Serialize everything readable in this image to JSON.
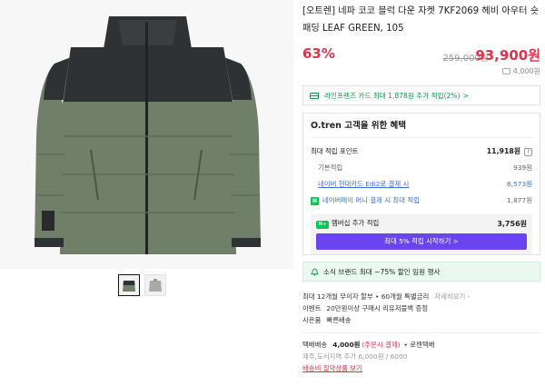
{
  "product": {
    "title": "[오트렌] 네파 코코 블럭 다운 자켓 7KF2069 헤비 아우터 숏 패딩 LEAF GREEN, 105",
    "discount_rate": "63%",
    "original_price": "259,000원",
    "final_price": "93,900원",
    "points_reward": "4,000원",
    "colors": {
      "sale": "#e0334b",
      "accent_green": "#0a9a49",
      "member_button": "#6a44ee",
      "jacket_top": "#2f3234",
      "jacket_bottom": "#6f7f68"
    }
  },
  "thumbnails": [
    {
      "name": "black-green-jacket",
      "active": true
    },
    {
      "name": "grey-jacket",
      "active": false
    }
  ],
  "card_promo": {
    "text": "라인프렌즈 카드 최대 1,878원 추가 적립(2%)",
    "chevron": ">"
  },
  "benefit": {
    "title": "O.tren 고객을 위한 혜택",
    "max_points_label": "최대 적립 포인트",
    "max_points_value": "11,918원",
    "help_icon": "?",
    "rows": [
      {
        "label": "기본적립",
        "value": "939원"
      },
      {
        "label": "네이버 현대카드 Edi2로 결제 시",
        "value": "6,573원"
      },
      {
        "label": "네이버페이 머니 결제 시 최대 적립",
        "value": "1,877원"
      }
    ],
    "npay_badge": "N",
    "membership_badge": "N+",
    "membership_label": "멤버십 추가 적립",
    "membership_value": "3,756원",
    "membership_button": "최대 5% 적립 시작하기 >"
  },
  "news": {
    "text": "소식 브랜드 최대 ~75% 할인 임원 행사"
  },
  "info": {
    "installment": "최대 12개월 무이자 할부 • 60개월 특별금리",
    "installment_link": "자세히보기",
    "event_label": "이벤트",
    "event_text": "20만원이상 구매시 리유저블백 증정",
    "gift_label": "사은품",
    "gift_text": "빠른배송",
    "delivery_label": "택배배송",
    "delivery_price": "4,000원",
    "delivery_note": "(주문시 결제)",
    "delivery_carrier": "• 로젠택배",
    "island_fee": "제주,도서지역 추가 6,000원 / 6000",
    "bundle_link": "배송비 절약상품 보기"
  }
}
